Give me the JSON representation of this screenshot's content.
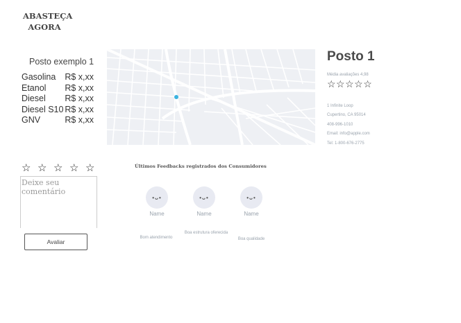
{
  "logo": {
    "line1": "ABASTEÇA",
    "line2": "AGORA"
  },
  "prices": {
    "title": "Posto exemplo 1",
    "items": [
      {
        "fuel": "Gasolina",
        "price": "R$ x,xx"
      },
      {
        "fuel": "Etanol",
        "price": "R$ x,xx"
      },
      {
        "fuel": "Diesel",
        "price": "R$ x,xx"
      },
      {
        "fuel": "Diesel S10",
        "price": "R$ x,xx"
      },
      {
        "fuel": "GNV",
        "price": "R$ x,xx"
      }
    ]
  },
  "station": {
    "title": "Posto 1",
    "avg_label": "Média avaliações 4,98",
    "stars": "☆☆☆☆☆",
    "contact": {
      "address1": "1 Infinite Loop",
      "address2": "Cupertino, CA 95014",
      "phone": "408-996-1010",
      "email": "Email: info@apple.com",
      "tel": "Tel: 1-800-676-2775"
    }
  },
  "rating": {
    "stars": [
      "☆",
      "☆",
      "☆",
      "☆",
      "☆"
    ],
    "comment_placeholder": "Deixe seu comentário",
    "submit_label": "Avaliar"
  },
  "feedbacks": {
    "title": "Últimos Feedbacks registrados dos Consumidores",
    "items": [
      {
        "face": "•ᴗ•",
        "name": "Name",
        "text": "Bom atendimento"
      },
      {
        "face": "•ᴗ•",
        "name": "Name",
        "text": "Boa estrutura oferecida"
      },
      {
        "face": "•ᴗ•",
        "name": "Name",
        "text": "Boa qualidade"
      }
    ]
  },
  "colors": {
    "map_bg": "#eef0f4",
    "map_road": "#ffffff",
    "map_pin": "#3bb3e0",
    "muted_text": "#9aa3ad"
  }
}
